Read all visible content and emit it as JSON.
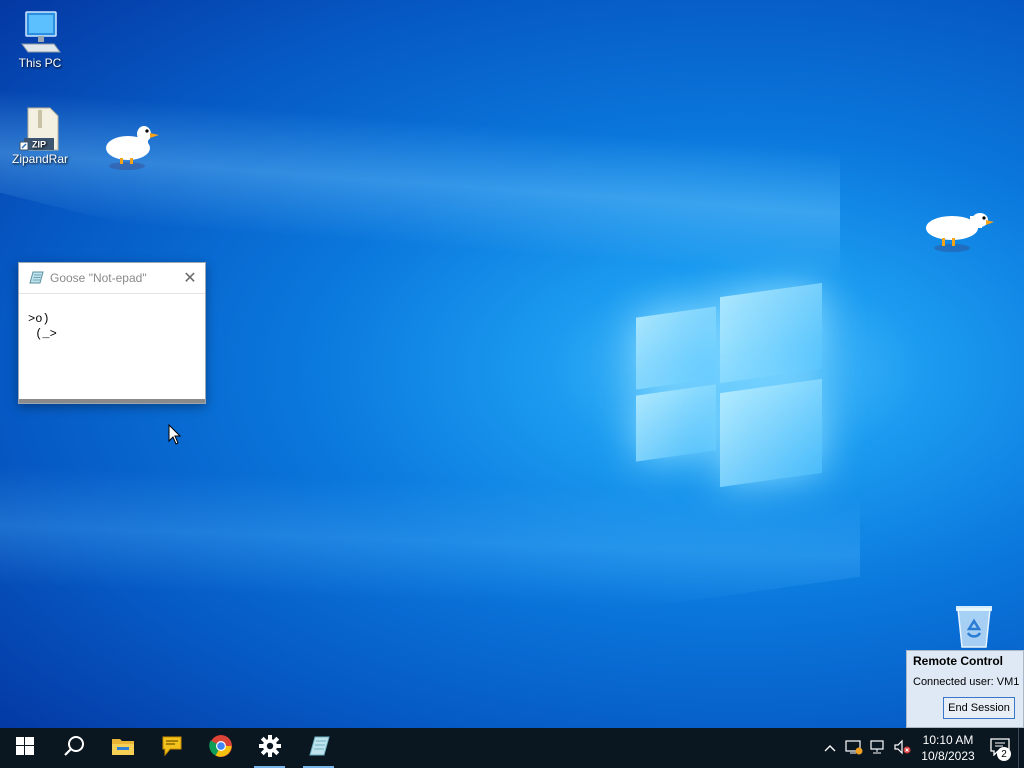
{
  "desktop": {
    "icons": [
      {
        "label": "This PC",
        "icon": "this-pc-icon"
      },
      {
        "label": "ZipandRar",
        "icon": "zip-archive-icon",
        "badge": "ZIP"
      }
    ],
    "recycle_bin_icon": "recycle-bin-icon"
  },
  "notepad_window": {
    "title": "Goose \"Not-epad\"",
    "line1": ">o)",
    "line2": " (_>",
    "close_icon": "close-icon"
  },
  "remote_control": {
    "title": "Remote Control",
    "connected_user": "Connected user: VM1",
    "end_session_label": "End Session"
  },
  "taskbar": {
    "buttons": [
      {
        "name": "start-button",
        "icon": "windows-logo-icon"
      },
      {
        "name": "search-button",
        "icon": "search-icon"
      },
      {
        "name": "file-explorer-button",
        "icon": "folder-icon"
      },
      {
        "name": "chat-app-button",
        "icon": "speech-bubble-icon"
      },
      {
        "name": "chrome-button",
        "icon": "chrome-icon"
      },
      {
        "name": "settings-button",
        "icon": "gear-icon"
      },
      {
        "name": "notepad-button",
        "icon": "notepad-icon"
      }
    ],
    "clock": {
      "time": "10:10 AM",
      "date": "10/8/2023"
    },
    "notification_count": "2"
  },
  "colors": {
    "taskbar_bg": "#0a1620",
    "desktop_accent": "#0a77dc",
    "remote_panel_bg": "#dfe9f5"
  }
}
